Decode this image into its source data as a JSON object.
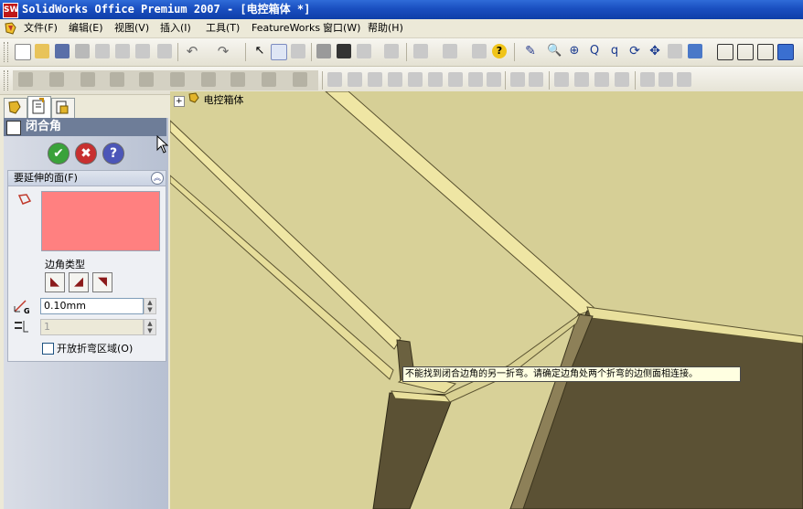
{
  "window": {
    "title": "SolidWorks Office Premium 2007 - [电控箱体 *]",
    "logo_text": "SW"
  },
  "menubar": {
    "items": [
      "文件(F)",
      "编辑(E)",
      "视图(V)",
      "插入(I)",
      "工具(T)",
      "FeatureWorks",
      "窗口(W)",
      "帮助(H)"
    ]
  },
  "left_panel": {
    "title": "闭合角",
    "ok_label": "✔",
    "cancel_label": "✖",
    "help_label": "?",
    "group_title": "要延伸的面(F)",
    "corner_type_label": "边角类型",
    "gap_value": "0.10mm",
    "overlap_value": "1",
    "open_bend_label": "开放折弯区域(O)",
    "open_bend_checked": false
  },
  "viewport": {
    "tree_root": "电控箱体",
    "tooltip": "不能找到闭合边角的另一折弯。请确定边角处两个折弯的边侧面相连接。"
  },
  "colors": {
    "face_selection": "#ff8080",
    "model_face": "#d8d198",
    "dark_face": "#5b5134"
  },
  "icons": [
    "solidworks-icon",
    "new-icon",
    "open-icon",
    "save-icon",
    "print-icon",
    "undo-icon",
    "redo-icon",
    "select-icon",
    "rebuild-icon",
    "zoom-fit-icon",
    "zoom-area-icon",
    "rotate-icon",
    "pan-icon",
    "help-icon"
  ]
}
